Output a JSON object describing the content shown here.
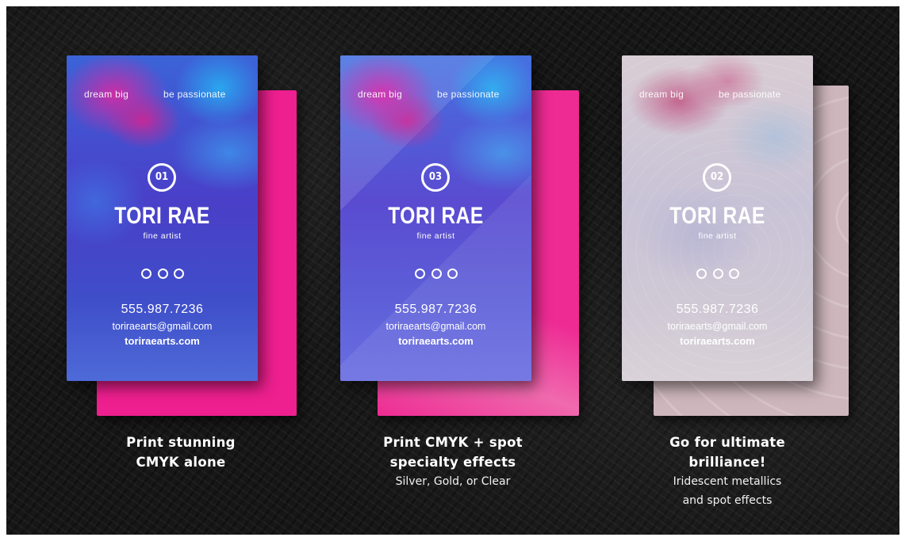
{
  "cards": [
    {
      "tagline_left": "dream big",
      "tagline_right": "be passionate",
      "number": "01",
      "name": "TORI RAE",
      "role": "fine artist",
      "phone": "555.987.7236",
      "email": "toriraearts@gmail.com",
      "website": "toriraearts.com",
      "back_color": "#ee1f8f"
    },
    {
      "tagline_left": "dream big",
      "tagline_right": "be passionate",
      "number": "03",
      "name": "TORI RAE",
      "role": "fine artist",
      "phone": "555.987.7236",
      "email": "toriraearts@gmail.com",
      "website": "toriraearts.com",
      "back_color": "#ee2a93"
    },
    {
      "tagline_left": "dream big",
      "tagline_right": "be passionate",
      "number": "02",
      "name": "TORI RAE",
      "role": "fine artist",
      "phone": "555.987.7236",
      "email": "toriraearts@gmail.com",
      "website": "toriraearts.com",
      "back_color": "#cdb6bc"
    }
  ],
  "captions": [
    {
      "title_line1": "Print stunning",
      "title_line2": "CMYK alone",
      "sub_line1": "",
      "sub_line2": ""
    },
    {
      "title_line1": "Print CMYK + spot",
      "title_line2": "specialty effects",
      "sub_line1": "Silver, Gold, or Clear",
      "sub_line2": ""
    },
    {
      "title_line1": "Go for ultimate",
      "title_line2": "brilliance!",
      "sub_line1": "Iridescent metallics",
      "sub_line2": "and spot effects"
    }
  ]
}
